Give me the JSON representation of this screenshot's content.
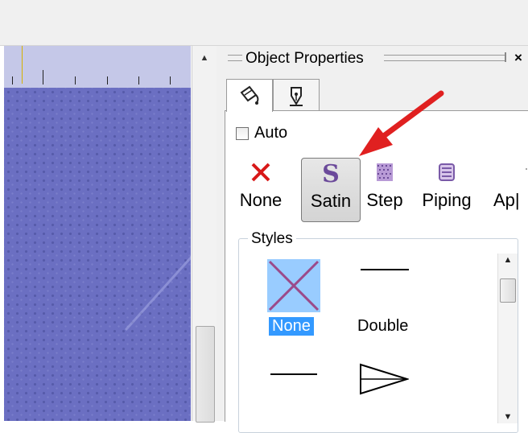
{
  "panel": {
    "title": "Object Properties",
    "close_label": "×",
    "tabs": [
      {
        "icon": "paint-bucket-icon",
        "active": true
      },
      {
        "icon": "pen-nib-icon",
        "active": false
      }
    ]
  },
  "auto_checkbox": {
    "label": "Auto",
    "checked": false
  },
  "fill_types": [
    {
      "label": "None",
      "icon": "red-x-icon",
      "selected": false
    },
    {
      "label": "Satin",
      "icon": "satin-s-icon",
      "selected": true
    },
    {
      "label": "Step",
      "icon": "step-fill-icon",
      "selected": false
    },
    {
      "label": "Piping",
      "icon": "piping-icon",
      "selected": false
    },
    {
      "label": "Ap|",
      "icon": "applique-icon",
      "selected": false
    }
  ],
  "styles": {
    "group_label": "Styles",
    "items": [
      {
        "label": "None",
        "icon": "none-style-icon",
        "selected": true
      },
      {
        "label": "Double",
        "icon": "double-line-icon",
        "selected": false
      },
      {
        "label": "",
        "icon": "single-line-icon",
        "selected": false
      },
      {
        "label": "",
        "icon": "arrow-style-icon",
        "selected": false
      }
    ]
  },
  "colors": {
    "canvas": "#6e72c4",
    "selection": "#3399ff",
    "annotation_arrow": "#e02020"
  }
}
